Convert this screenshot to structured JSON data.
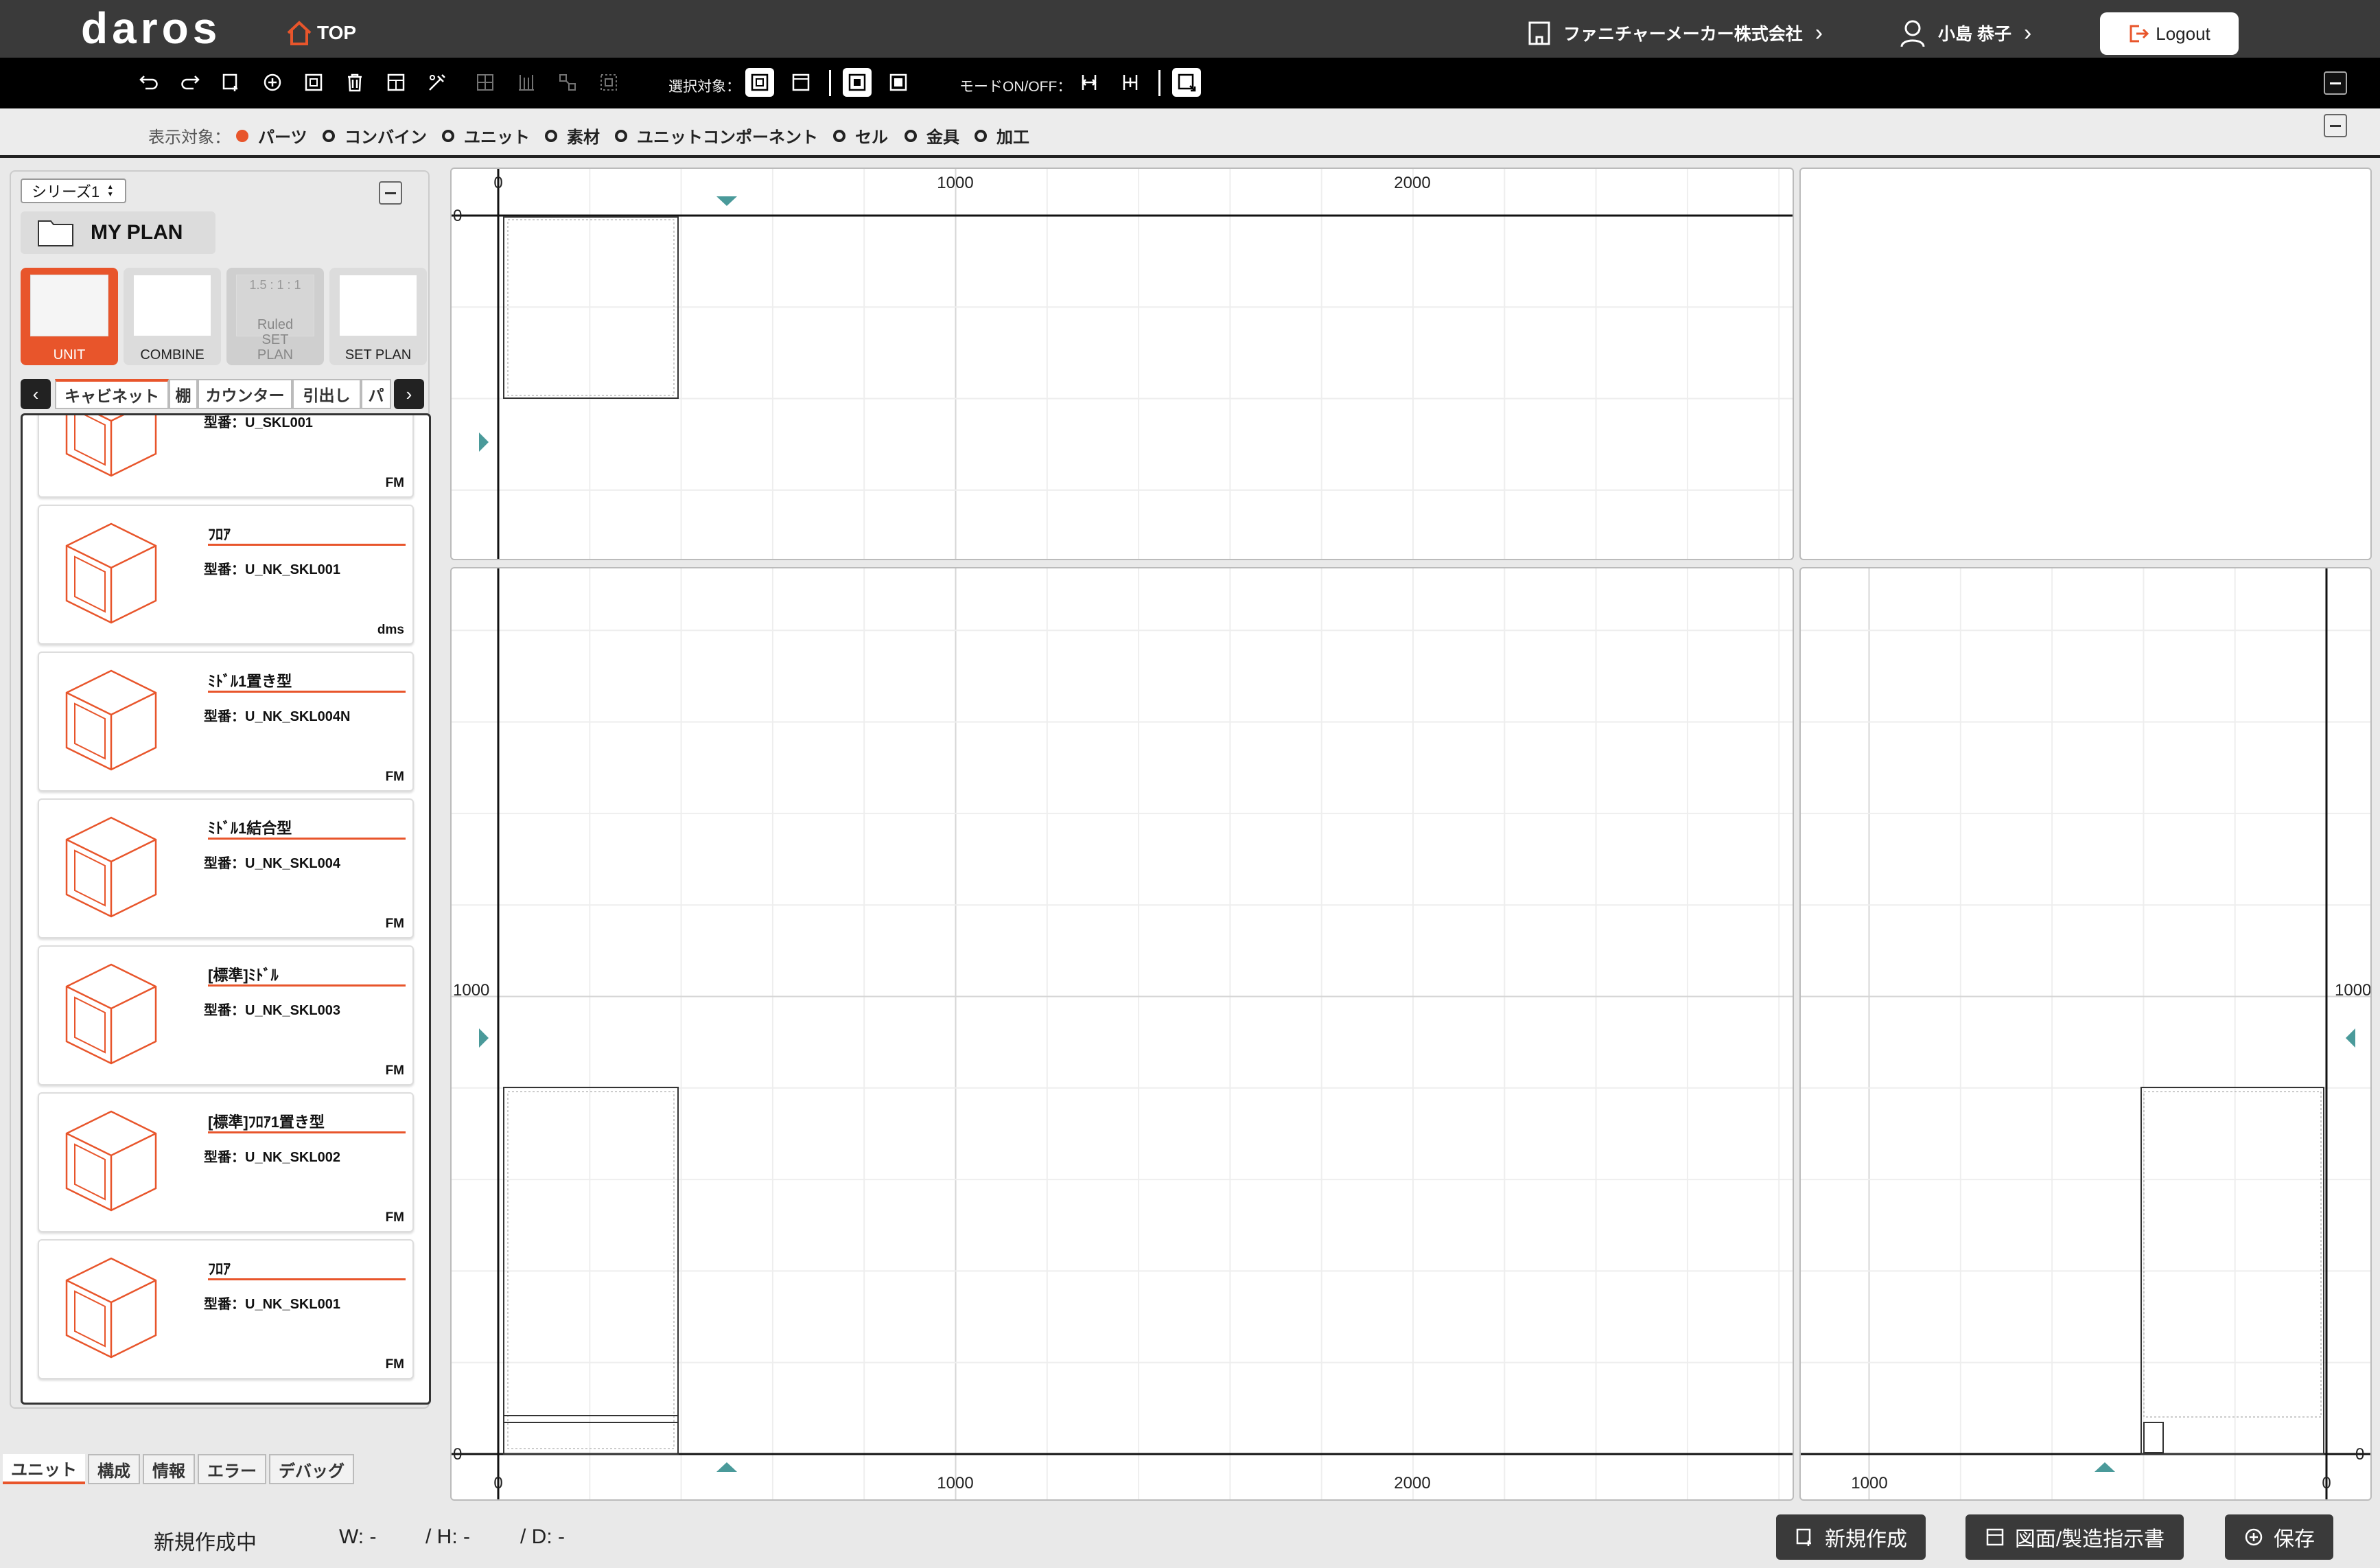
{
  "header": {
    "logo": "daros",
    "top_link": "TOP",
    "company": "ファニチャーメーカー株式会社",
    "user": "小島 恭子",
    "logout": "Logout"
  },
  "toolbar": {
    "select_target_label": "選択対象：",
    "mode_label": "モードON/OFF："
  },
  "filter": {
    "label": "表示対象：",
    "items": [
      {
        "label": "パーツ",
        "selected": true
      },
      {
        "label": "コンバイン",
        "selected": false
      },
      {
        "label": "ユニット",
        "selected": false
      },
      {
        "label": "素材",
        "selected": false
      },
      {
        "label": "ユニットコンポーネント",
        "selected": false
      },
      {
        "label": "セル",
        "selected": false
      },
      {
        "label": "金具",
        "selected": false
      },
      {
        "label": "加工",
        "selected": false
      }
    ]
  },
  "left_panel": {
    "series": "シリーズ1",
    "my_plan": "MY PLAN",
    "categories": [
      {
        "label": "UNIT",
        "state": "selected"
      },
      {
        "label": "COMBINE",
        "state": "normal"
      },
      {
        "label": "Ruled SET PLAN",
        "state": "disabled",
        "thumb_text": "1.5 : 1 : 1"
      },
      {
        "label": "SET PLAN",
        "state": "normal"
      }
    ],
    "tabs": [
      "キャビネット",
      "棚",
      "カウンター",
      "引出し",
      "パ"
    ],
    "cards": [
      {
        "name": "",
        "model": "型番：U_SKL001",
        "maker": "FM"
      },
      {
        "name": "ﾌﾛｱ",
        "model": "型番：U_NK_SKL001",
        "maker": "dms"
      },
      {
        "name": "ﾐﾄﾞﾙ1置き型",
        "model": "型番：U_NK_SKL004N",
        "maker": "FM"
      },
      {
        "name": "ﾐﾄﾞﾙ1結合型",
        "model": "型番：U_NK_SKL004",
        "maker": "FM"
      },
      {
        "name": "[標準]ﾐﾄﾞﾙ",
        "model": "型番：U_NK_SKL003",
        "maker": "FM"
      },
      {
        "name": "[標準]ﾌﾛｱ1置き型",
        "model": "型番：U_NK_SKL002",
        "maker": "FM"
      },
      {
        "name": "ﾌﾛｱ",
        "model": "型番：U_NK_SKL001",
        "maker": "FM"
      }
    ],
    "bottom_tabs": [
      "ユニット",
      "構成",
      "情報",
      "エラー",
      "デバッグ"
    ]
  },
  "canvas": {
    "top_x_ticks": [
      "0",
      "1000",
      "2000"
    ],
    "top_y_ticks": [
      "0"
    ],
    "front_x_ticks": [
      "0",
      "1000",
      "2000"
    ],
    "front_y_ticks": [
      "1000",
      "0"
    ],
    "side_x_ticks": [
      "1000",
      "0"
    ],
    "side_y_ticks": [
      "1000",
      "0"
    ]
  },
  "status": {
    "state": "新規作成中",
    "w": "W: -",
    "h": "/ H: -",
    "d": "/ D: -",
    "new_button": "新規作成",
    "drawing_button": "図面/製造指示書",
    "save_button": "保存"
  },
  "colors": {
    "accent": "#e8552b",
    "marker": "#4a9a9a",
    "dark": "#3a3a3a"
  }
}
